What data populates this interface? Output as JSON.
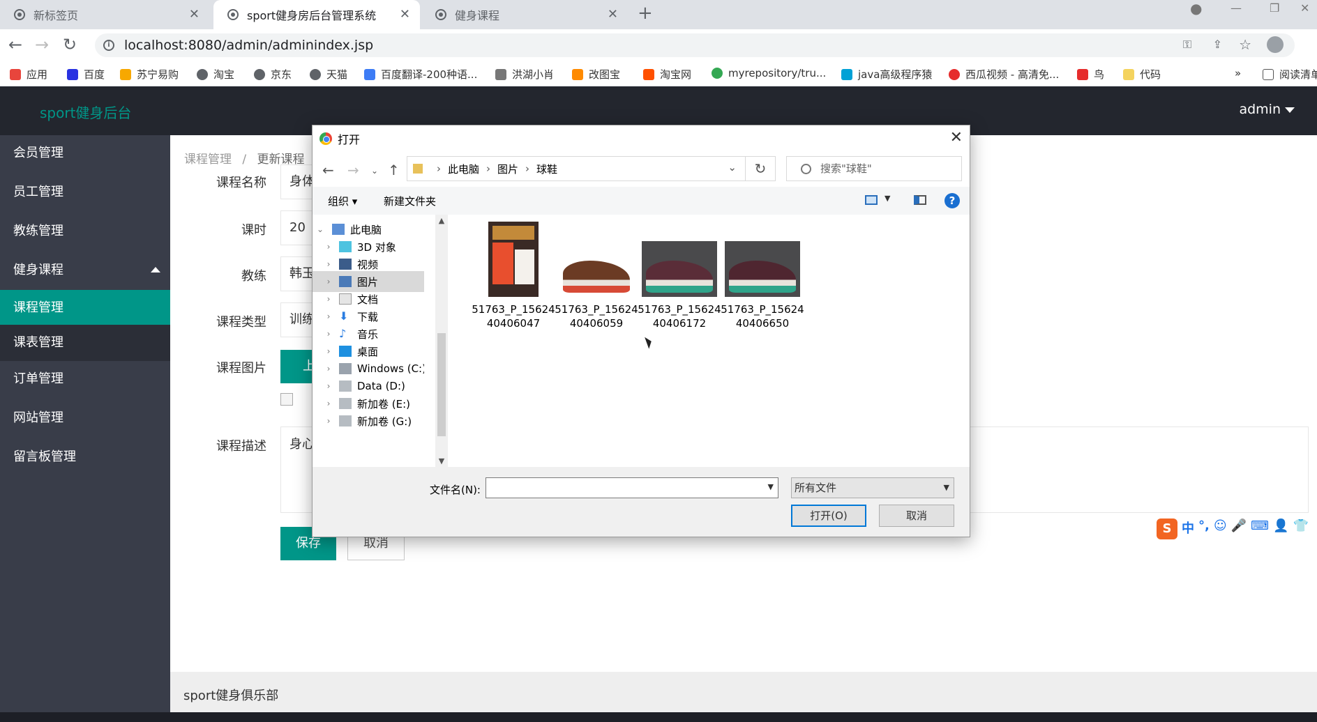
{
  "browser": {
    "tabs": [
      {
        "label": "新标签页",
        "active": false
      },
      {
        "label": "sport健身房后台管理系统",
        "active": true
      },
      {
        "label": "健身课程",
        "active": false
      }
    ],
    "url": "localhost:8080/admin/adminindex.jsp",
    "bookmarks": [
      {
        "label": "应用",
        "color": "#e8453c"
      },
      {
        "label": "百度",
        "color": "#2932e1"
      },
      {
        "label": "苏宁易购",
        "color": "#f7a800"
      },
      {
        "label": "淘宝",
        "color": "#5f6368"
      },
      {
        "label": "京东",
        "color": "#5f6368"
      },
      {
        "label": "天猫",
        "color": "#5f6368"
      },
      {
        "label": "百度翻译-200种语...",
        "color": "#3d7cf5"
      },
      {
        "label": "洪湖小肖",
        "color": "#777777"
      },
      {
        "label": "改图宝",
        "color": "#ff8a00"
      },
      {
        "label": "淘宝网",
        "color": "#ff5000"
      },
      {
        "label": "myrepository/tru...",
        "color": "#34a853"
      },
      {
        "label": "java高级程序猿",
        "color": "#00a1d6"
      },
      {
        "label": "西瓜视频 - 高清免...",
        "color": "#e62c2c"
      },
      {
        "label": "鸟",
        "color": "#e62c2c"
      },
      {
        "label": "代码",
        "color": "#f4d35e"
      }
    ],
    "more_label": "»",
    "reading_list": "阅读清单"
  },
  "app": {
    "brand": "sport健身后台",
    "user": "admin",
    "footer": "sport健身俱乐部"
  },
  "sidebar": {
    "items": [
      {
        "label": "会员管理"
      },
      {
        "label": "员工管理"
      },
      {
        "label": "教练管理"
      },
      {
        "label": "健身课程"
      },
      {
        "label": "课程管理"
      },
      {
        "label": "课表管理"
      },
      {
        "label": "订单管理"
      },
      {
        "label": "网站管理"
      },
      {
        "label": "留言板管理"
      }
    ]
  },
  "breadcrumb": {
    "parent": "课程管理",
    "separator": "/",
    "current": "更新课程"
  },
  "form": {
    "name_label": "课程名称",
    "name_value": "身体",
    "hours_label": "课时",
    "hours_value": "20",
    "coach_label": "教练",
    "coach_value": "韩玉",
    "type_label": "课程类型",
    "type_value": "训练",
    "image_label": "课程图片",
    "upload_label": "上传",
    "desc_label": "课程描述",
    "desc_value": "身心",
    "save_label": "保存",
    "cancel_label": "取消"
  },
  "ime": {
    "logo": "S",
    "mode": "中",
    "punct": "°,"
  },
  "dialog": {
    "title": "打开",
    "path": [
      "此电脑",
      "图片",
      "球鞋"
    ],
    "search_placeholder": "搜索\"球鞋\"",
    "organize": "组织 ▾",
    "new_folder": "新建文件夹",
    "help": "?",
    "tree": [
      {
        "label": "此电脑",
        "icon": "computer-icon"
      },
      {
        "label": "3D 对象",
        "icon": "3d-objects-icon"
      },
      {
        "label": "视频",
        "icon": "video-icon"
      },
      {
        "label": "图片",
        "icon": "pictures-icon"
      },
      {
        "label": "文档",
        "icon": "documents-icon"
      },
      {
        "label": "下载",
        "icon": "download-icon"
      },
      {
        "label": "音乐",
        "icon": "music-icon"
      },
      {
        "label": "桌面",
        "icon": "desktop-icon"
      },
      {
        "label": "Windows (C:)",
        "icon": "drive-icon"
      },
      {
        "label": "Data (D:)",
        "icon": "drive-icon"
      },
      {
        "label": "新加卷 (E:)",
        "icon": "drive-icon"
      },
      {
        "label": "新加卷 (G:)",
        "icon": "drive-icon"
      }
    ],
    "files": [
      {
        "line1": "51763_P_15624",
        "line2": "40406047"
      },
      {
        "line1": "51763_P_15624",
        "line2": "40406059"
      },
      {
        "line1": "51763_P_15624",
        "line2": "40406172"
      },
      {
        "line1": "51763_P_15624",
        "line2": "40406650"
      }
    ],
    "filename_label": "文件名(N):",
    "filename_value": "",
    "filetype": "所有文件",
    "open_label": "打开(O)",
    "cancel_label": "取消"
  },
  "colors": {
    "accent": "#009688",
    "header": "#23262e",
    "sidebar": "#393d49"
  }
}
